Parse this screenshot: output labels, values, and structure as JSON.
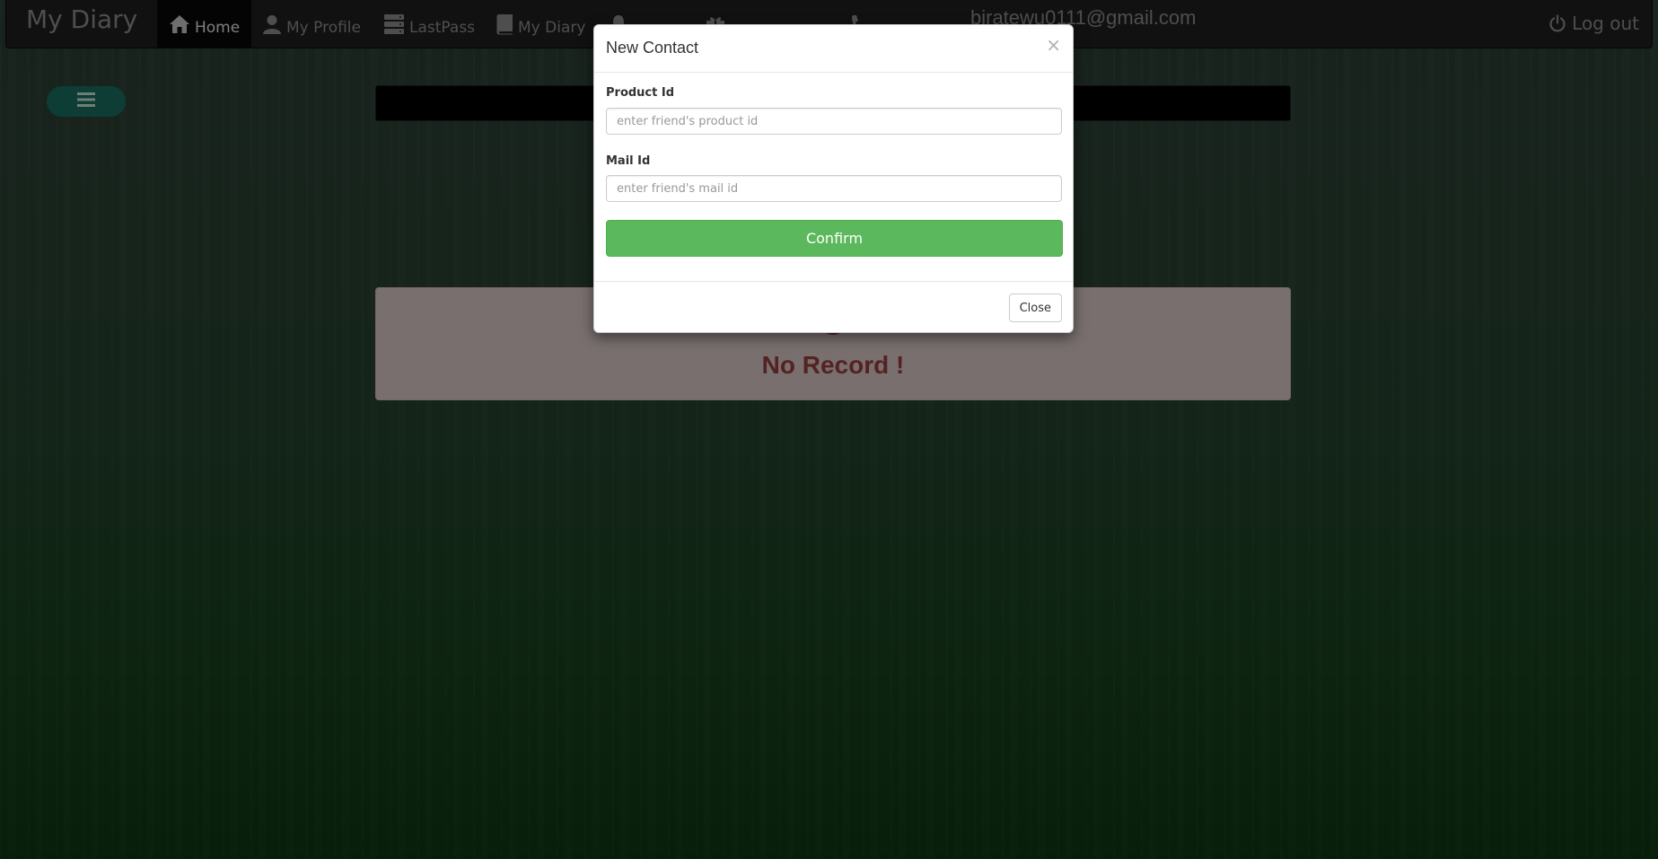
{
  "navbar": {
    "brand": "My Diary",
    "items": [
      {
        "label": "Home",
        "icon": "home-icon",
        "active": true
      },
      {
        "label": "My Profile",
        "icon": "user-icon"
      },
      {
        "label": "LastPass",
        "icon": "server-icon"
      },
      {
        "label": "My Diary",
        "icon": "book-icon"
      },
      {
        "label": "",
        "icon": "bell-icon"
      },
      {
        "label": "",
        "icon": "gift-icon"
      },
      {
        "label": "",
        "icon": "phone-icon"
      }
    ],
    "email": "biratewu0111@gmail.com",
    "logout": "Log out"
  },
  "main": {
    "alert_text": "No Record !"
  },
  "modal": {
    "title": "New Contact",
    "close_symbol": "×",
    "fields": [
      {
        "label": "Product Id",
        "placeholder": "enter friend's product id"
      },
      {
        "label": "Mail Id",
        "placeholder": "enter friend's mail id"
      }
    ],
    "confirm": "Confirm",
    "close": "Close"
  },
  "colors": {
    "navbar_bg": "#222222",
    "confirm_green": "#5cb85c",
    "toggle_teal": "#1a7a6a",
    "alert_red": "#a94442"
  }
}
